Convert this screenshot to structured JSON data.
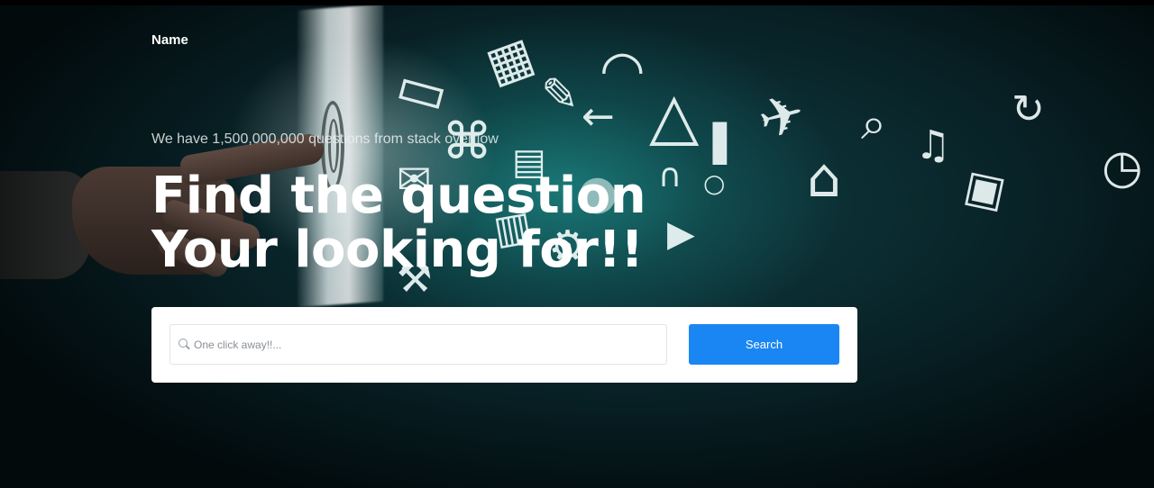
{
  "header": {
    "brand": "Name"
  },
  "hero": {
    "subtitle": "We have 1,500,000,000 questions from stack overflow",
    "headline": "Find the question Your looking for!!"
  },
  "search": {
    "placeholder": "One click away!!...",
    "value": "",
    "button_label": "Search"
  },
  "background_icons": [
    {
      "name": "wifi-icon",
      "glyph": "◠"
    },
    {
      "name": "calculator-icon",
      "glyph": "▦"
    },
    {
      "name": "credit-card-icon",
      "glyph": "▭"
    },
    {
      "name": "pen-icon",
      "glyph": "✎"
    },
    {
      "name": "hanger-icon",
      "glyph": "△"
    },
    {
      "name": "airplane-icon",
      "glyph": "✈"
    },
    {
      "name": "magnifier-icon",
      "glyph": "⌕"
    },
    {
      "name": "refresh-icon",
      "glyph": "↻"
    },
    {
      "name": "music-note-icon",
      "glyph": "♫"
    },
    {
      "name": "clock-icon",
      "glyph": "◷"
    },
    {
      "name": "camera-icon",
      "glyph": "▣"
    },
    {
      "name": "home-icon",
      "glyph": "⌂"
    },
    {
      "name": "signal-bars-icon",
      "glyph": "▐"
    },
    {
      "name": "shopping-cart-icon",
      "glyph": "⌘"
    },
    {
      "name": "arrow-left-icon",
      "glyph": "←"
    },
    {
      "name": "briefcase-icon",
      "glyph": "▤"
    },
    {
      "name": "headphones-icon",
      "glyph": "∩"
    },
    {
      "name": "envelope-icon",
      "glyph": "✉"
    },
    {
      "name": "dish-icon",
      "glyph": "●"
    },
    {
      "name": "gears-icon",
      "glyph": "⚙"
    },
    {
      "name": "wrench-icon",
      "glyph": "⚒"
    },
    {
      "name": "video-camera-icon",
      "glyph": "▶"
    },
    {
      "name": "lock-icon",
      "glyph": "▥"
    },
    {
      "name": "microphone-icon",
      "glyph": "○"
    }
  ],
  "colors": {
    "accent": "#1a86f3",
    "background": "#061012",
    "teal_glow": "#23aaa5"
  }
}
